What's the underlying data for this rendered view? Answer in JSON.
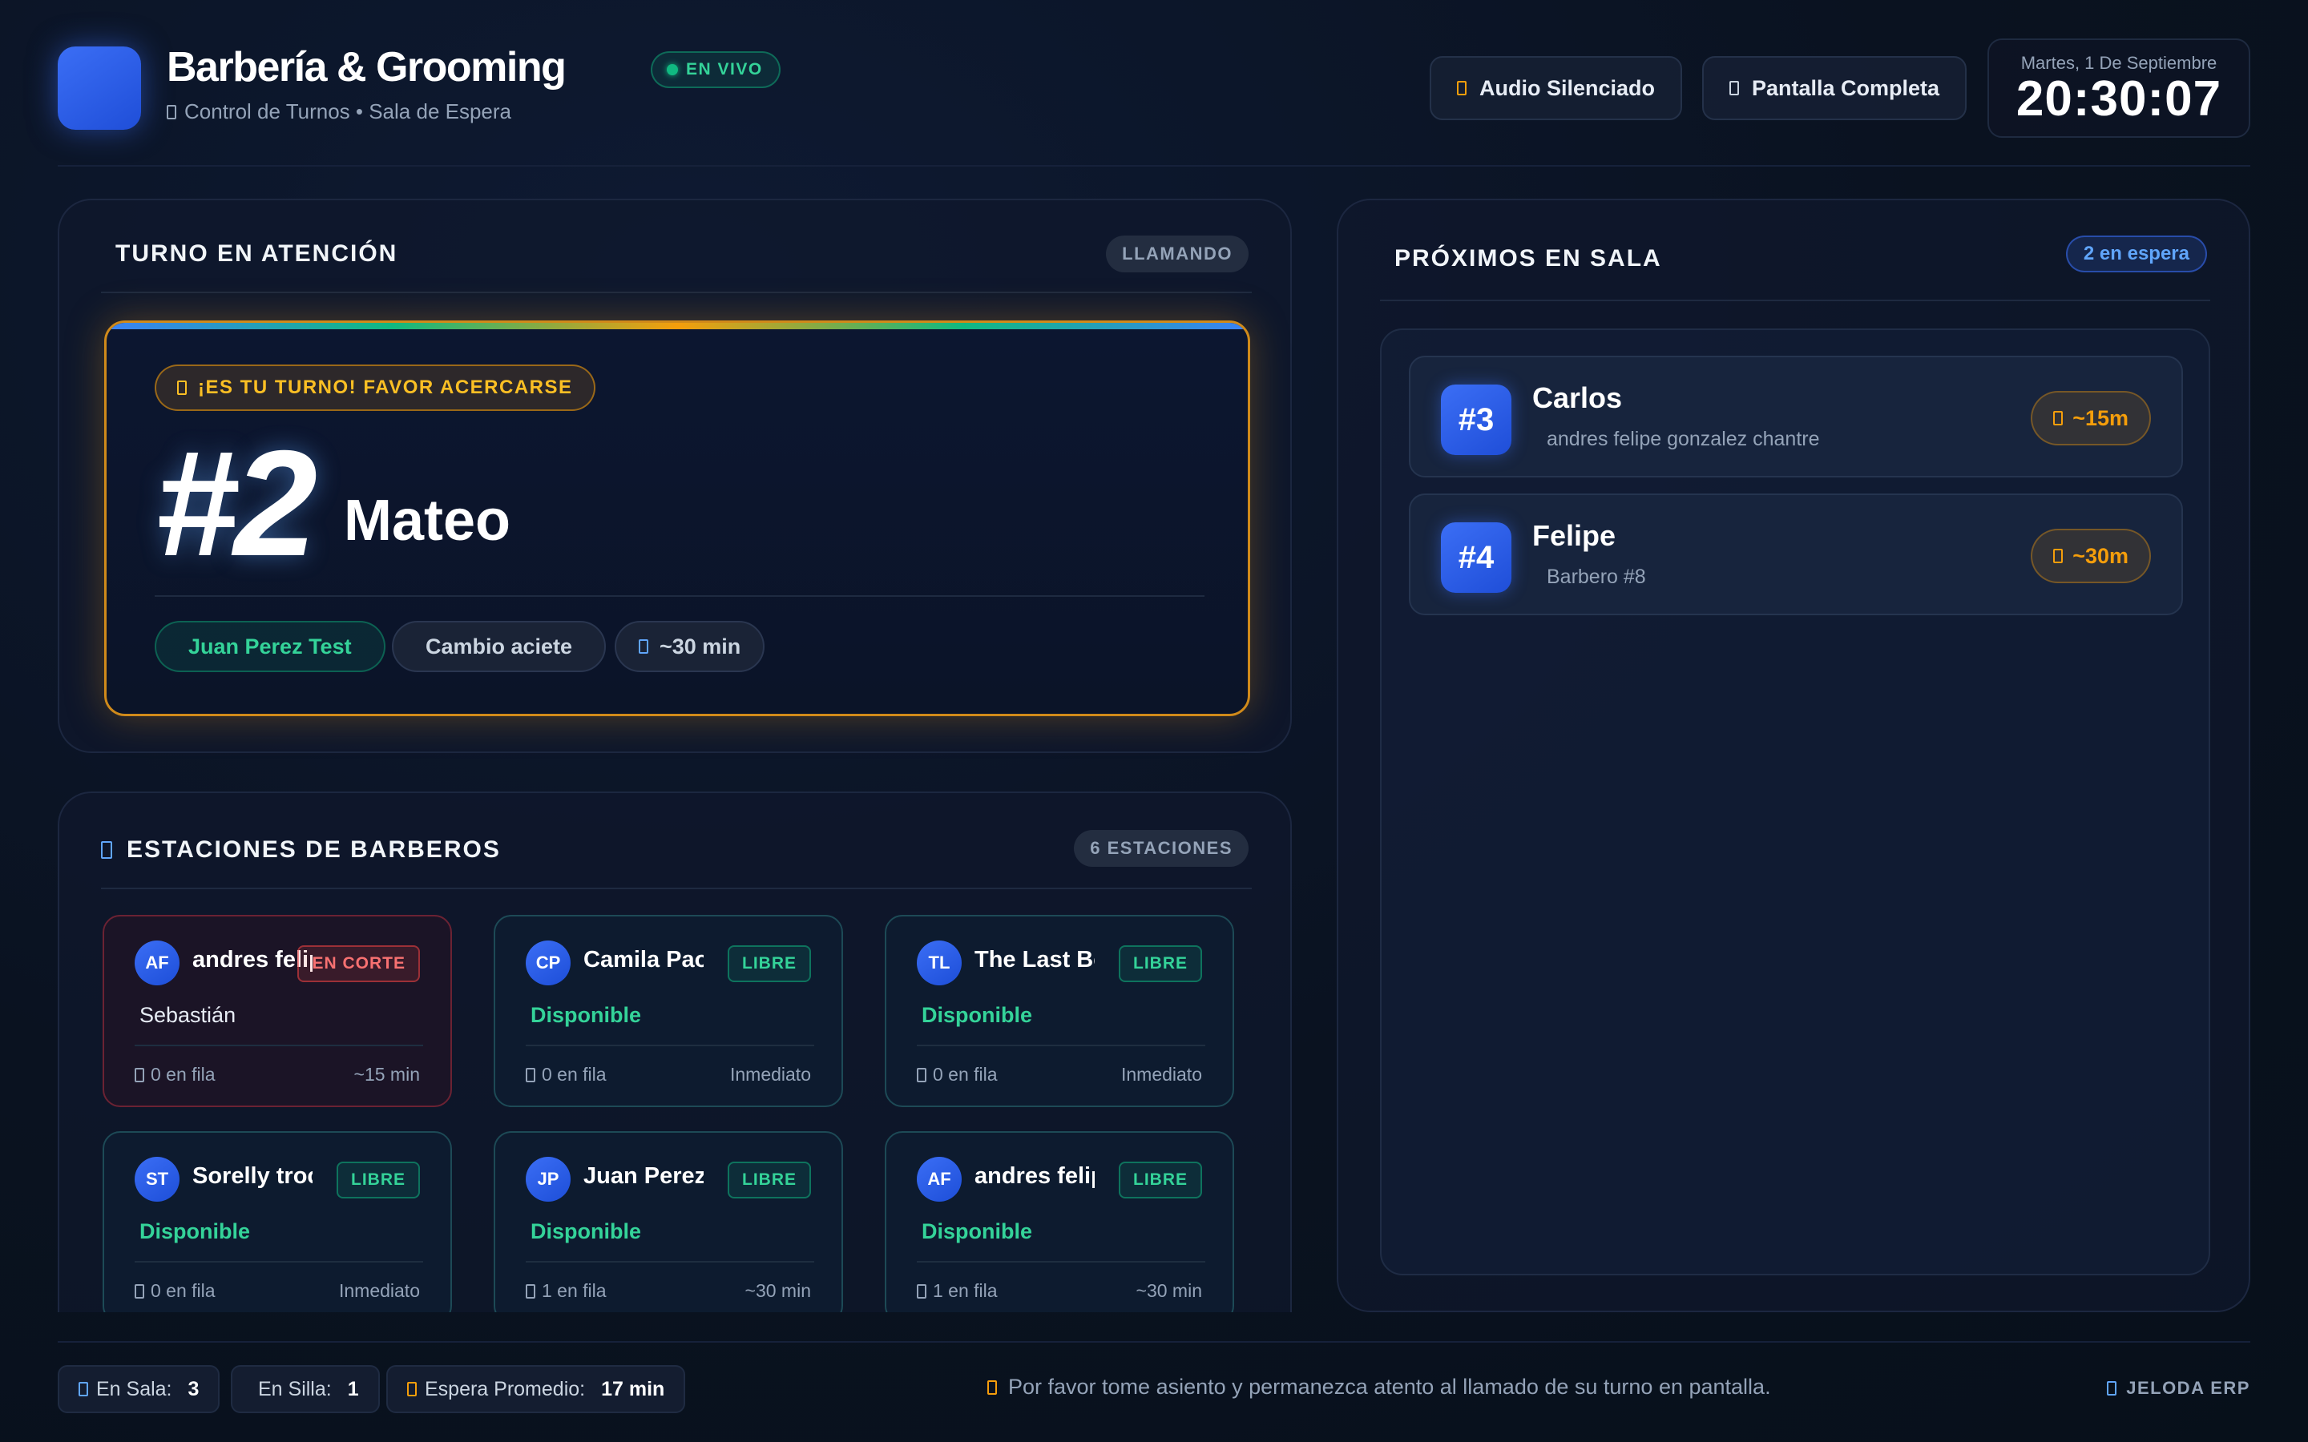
{
  "header": {
    "title": "Barbería & Grooming",
    "live_label": "EN VIVO",
    "subtitle": "Control de Turnos • Sala de Espera",
    "audio_button": "Audio Silenciado",
    "fullscreen_button": "Pantalla Completa",
    "date": "Martes, 1 De Septiembre",
    "time": "20:30:07"
  },
  "current": {
    "panel_title": "TURNO EN ATENCIÓN",
    "status_pill": "LLAMANDO",
    "call_label": "¡ES TU TURNO! FAVOR ACERCARSE",
    "number": "#2",
    "client_name": "Mateo",
    "barber": "Juan Perez Test",
    "service": "Cambio aciete",
    "duration": "~30 min"
  },
  "stations": {
    "panel_title": "ESTACIONES DE BARBEROS",
    "count_pill": "6 ESTACIONES",
    "items": [
      {
        "initials": "AF",
        "name": "andres felipe gonzalez chantre",
        "badge": "EN CORTE",
        "status": "Sebastián",
        "queue": "0 en fila",
        "eta": "~15 min"
      },
      {
        "initials": "CP",
        "name": "Camila Paola Suarez",
        "badge": "LIBRE",
        "status": "Disponible",
        "queue": "0 en fila",
        "eta": "Inmediato"
      },
      {
        "initials": "TL",
        "name": "The Last Beyond",
        "badge": "LIBRE",
        "status": "Disponible",
        "queue": "0 en fila",
        "eta": "Inmediato"
      },
      {
        "initials": "ST",
        "name": "Sorelly trochez",
        "badge": "LIBRE",
        "status": "Disponible",
        "queue": "0 en fila",
        "eta": "Inmediato"
      },
      {
        "initials": "JP",
        "name": "Juan Perez Test",
        "badge": "LIBRE",
        "status": "Disponible",
        "queue": "1 en fila",
        "eta": "~30 min"
      },
      {
        "initials": "AF",
        "name": "andres felipe gonzalez",
        "badge": "LIBRE",
        "status": "Disponible",
        "queue": "1 en fila",
        "eta": "~30 min"
      }
    ]
  },
  "next": {
    "panel_title": "PRÓXIMOS EN SALA",
    "waiting_pill": "2 en espera",
    "items": [
      {
        "number": "#3",
        "name": "Carlos",
        "subtitle": "andres felipe gonzalez chantre",
        "eta": "~15m"
      },
      {
        "number": "#4",
        "name": "Felipe",
        "subtitle": "Barbero #8",
        "eta": "~30m"
      }
    ]
  },
  "footer": {
    "sala_label": "En Sala:",
    "sala_value": "3",
    "silla_label": "En Silla:",
    "silla_value": "1",
    "espera_label": "Espera Promedio:",
    "espera_value": "17 min",
    "message": "Por favor tome asiento y permanezca atento al llamado de su turno en pantalla.",
    "brand": "JELODA ERP"
  },
  "colors": {
    "accent_blue": "#3b6ef5",
    "live_green": "#10b981",
    "call_amber": "#f59e0b",
    "busy_red": "#ef4444",
    "background": "#0a1220"
  },
  "icons": [
    "logo-tile",
    "live-dot-icon",
    "tv-icon",
    "speaker-muted-icon",
    "fullscreen-icon",
    "bell-icon",
    "clock-icon",
    "scissors-icon",
    "user-icon",
    "hourglass-icon",
    "info-icon",
    "brand-icon"
  ]
}
